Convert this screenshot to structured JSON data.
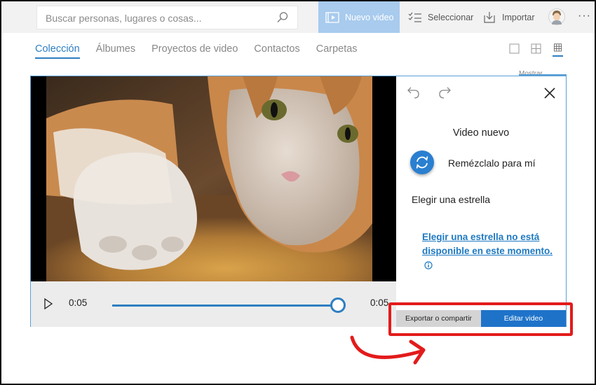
{
  "search": {
    "placeholder": "Buscar personas, lugares o cosas..."
  },
  "toolbar": {
    "new_video": "Nuevo video",
    "select": "Seleccionar",
    "import": "Importar",
    "more": "···"
  },
  "nav": {
    "items": [
      "Colección",
      "Álbumes",
      "Proyectos de video",
      "Contactos",
      "Carpetas"
    ],
    "active_index": 0,
    "show_more": "Mostrar"
  },
  "player": {
    "current_time": "0:05",
    "end_time": "0:05",
    "progress": 1.0
  },
  "panel": {
    "title": "Video nuevo",
    "remix_label": "Remézclalo para mí",
    "star_label": "Elegir una estrella",
    "star_note": "Elegir una estrella no está disponible en este momento."
  },
  "buttons": {
    "export": "Exportar o compartir",
    "edit": "Editar video"
  },
  "colors": {
    "accent": "#2d7fc1",
    "new_video_bg": "#a8cbee",
    "edit_button": "#1e73c9",
    "highlight": "#e31b1b"
  }
}
